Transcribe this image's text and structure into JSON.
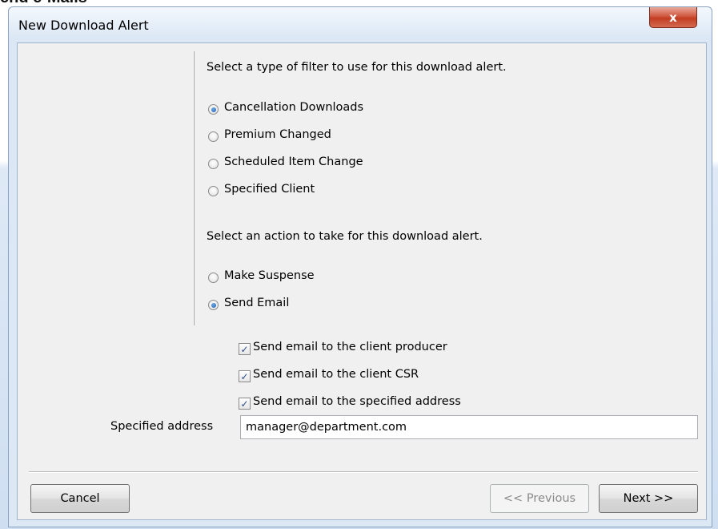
{
  "background": {
    "partial_heading": "end e-Mails"
  },
  "window": {
    "title": "New Download Alert",
    "close_glyph": "x"
  },
  "filter_section": {
    "prompt": "Select a type of filter to use for this download alert.",
    "options": [
      {
        "label": "Cancellation Downloads",
        "checked": true
      },
      {
        "label": "Premium Changed",
        "checked": false
      },
      {
        "label": "Scheduled Item Change",
        "checked": false
      },
      {
        "label": "Specified Client",
        "checked": false
      }
    ]
  },
  "action_section": {
    "prompt": "Select an action to take for this download alert.",
    "options": [
      {
        "label": "Make Suspense",
        "checked": false
      },
      {
        "label": "Send Email",
        "checked": true
      }
    ]
  },
  "email_options": [
    {
      "label": "Send email to the client producer",
      "checked": true
    },
    {
      "label": "Send email to the client CSR",
      "checked": true
    },
    {
      "label": "Send email to the specified address",
      "checked": true
    }
  ],
  "specified_address": {
    "label": "Specified address",
    "value": "manager@department.com"
  },
  "buttons": {
    "cancel": "Cancel",
    "previous": "<< Previous",
    "next": "Next >>"
  },
  "icons": {
    "check_glyph": "✓"
  }
}
